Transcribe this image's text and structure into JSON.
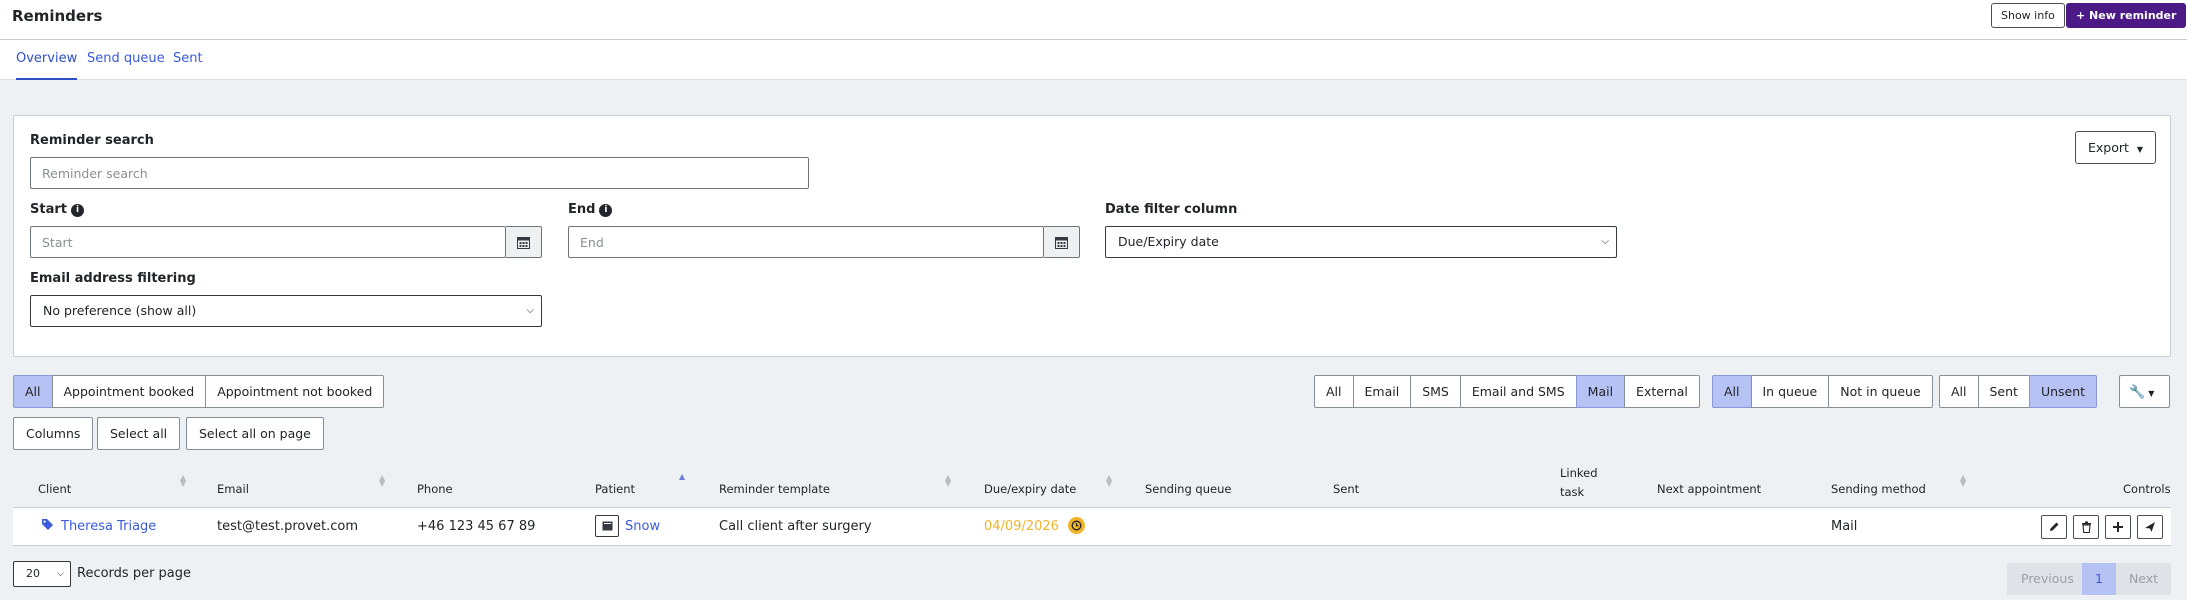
{
  "header": {
    "title": "Reminders",
    "show_info": "Show info",
    "new_reminder": "+ New reminder"
  },
  "tabs": [
    {
      "label": "Overview",
      "active": true
    },
    {
      "label": "Send queue",
      "active": false
    },
    {
      "label": "Sent",
      "active": false
    }
  ],
  "filters": {
    "export_label": "Export",
    "search_label": "Reminder search",
    "search_placeholder": "Reminder search",
    "start_label": "Start",
    "start_placeholder": "Start",
    "end_label": "End",
    "end_placeholder": "End",
    "date_column_label": "Date filter column",
    "date_column_value": "Due/Expiry date",
    "email_filter_label": "Email address filtering",
    "email_filter_value": "No preference (show all)"
  },
  "appointment_group": [
    "All",
    "Appointment booked",
    "Appointment not booked"
  ],
  "method_group": [
    "All",
    "Email",
    "SMS",
    "Email and SMS",
    "Mail",
    "External"
  ],
  "queue_group": [
    "All",
    "In queue",
    "Not in queue"
  ],
  "sent_group": [
    "All",
    "Sent",
    "Unsent"
  ],
  "active": {
    "appointment": "All",
    "method": "Mail",
    "queue": "All",
    "sent": "Unsent"
  },
  "actions": {
    "columns": "Columns",
    "select_all": "Select all",
    "select_all_page": "Select all on page"
  },
  "table": {
    "headers": {
      "client": "Client",
      "email": "Email",
      "phone": "Phone",
      "patient": "Patient",
      "template": "Reminder template",
      "due": "Due/expiry date",
      "queue": "Sending queue",
      "sent": "Sent",
      "linked_1": "Linked",
      "linked_2": "task",
      "next_appt": "Next appointment",
      "method": "Sending method",
      "controls": "Controls"
    },
    "rows": [
      {
        "client": "Theresa Triage",
        "email": "test@test.provet.com",
        "phone": "+46 123 45 67 89",
        "patient": "Snow",
        "template": "Call client after surgery",
        "due": "04/09/2026",
        "queue": "",
        "sent": "",
        "linked_task": "",
        "next_appointment": "",
        "method": "Mail"
      }
    ]
  },
  "footer": {
    "per_page": "20",
    "per_page_label": "Records per page",
    "previous": "Previous",
    "page": "1",
    "next": "Next"
  },
  "colors": {
    "brand": "#4b1a86",
    "link": "#3b5bdb",
    "toggle_active": "#b6c2f3",
    "due_warning": "#f0b429"
  }
}
